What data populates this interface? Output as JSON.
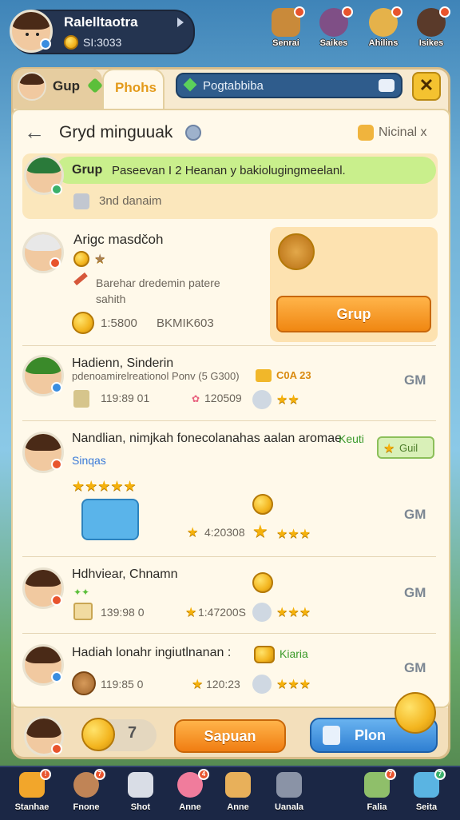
{
  "profile": {
    "name": "Ralelltaotra",
    "coins": "SI:3033"
  },
  "top_icons": [
    {
      "label": "Senrai",
      "icon": "shop-icon"
    },
    {
      "label": "Saikes",
      "icon": "character-icon"
    },
    {
      "label": "Ahilins",
      "icon": "hero-icon"
    },
    {
      "label": "Isikes",
      "icon": "girl-icon"
    }
  ],
  "tabs": {
    "first": "Gup",
    "second": "Phohs"
  },
  "search": {
    "text": "Pogtabbiba"
  },
  "panel": {
    "title": "Gryd minguuak",
    "right_label": "Nicinal x",
    "banner": {
      "title": "Grup",
      "text": "Paseevan I 2 Heanan y bakiolugingmeelanl.",
      "sub": "3nd danaim"
    }
  },
  "featured": {
    "title": "Arigc masdčoh",
    "line1": "Barehar dredemin patere",
    "line2": "sahith",
    "stat": "1:5800",
    "stat2": "BKMIK603",
    "button": "Grup"
  },
  "rows": [
    {
      "title": "Hadienn, Sinderin",
      "desc": "pdenoamirelreationol Ponv (5 G300)",
      "reward": "C0A 23",
      "time": "119:89 01",
      "code": "120509",
      "stars": "★★",
      "gm": "GM"
    },
    {
      "title": "Nandlian, nimjkah fonecolanahas aalan aromae",
      "tag": "Keuti",
      "sub": "Sinqas",
      "chip": "Guil",
      "time": "4:20308",
      "stars": "★★★",
      "gm": "GM",
      "rating": "★★★★★"
    },
    {
      "title": "Hdhviear, Chnamn",
      "time": "139:98 0",
      "code": "1:47200S",
      "stars": "★★★",
      "gm": "GM"
    },
    {
      "title": "Hadiah lonahr ingiutlnanan :",
      "tag": "Kiaria",
      "time": "119:85 0",
      "code": "120:23",
      "stars": "★★★",
      "gm": "GM"
    }
  ],
  "bottom": {
    "counter": "7",
    "primary": "Sapuan",
    "secondary": "Plon"
  },
  "nav": [
    {
      "label": "Stanhae",
      "badge": "!",
      "icon": "house-icon"
    },
    {
      "label": "Fnone",
      "badge": "7",
      "icon": "chat-icon"
    },
    {
      "label": "Shot",
      "badge": "",
      "icon": "ghost-icon"
    },
    {
      "label": "Anne",
      "badge": "4",
      "icon": "heart-icon"
    },
    {
      "label": "Anne",
      "badge": "",
      "icon": "gift-icon"
    },
    {
      "label": "Uanala",
      "badge": "",
      "icon": "controller-icon"
    },
    {
      "label": "Falia",
      "badge": "7",
      "icon": "book-icon"
    },
    {
      "label": "Seita",
      "badge": "7",
      "icon": "box-icon"
    }
  ],
  "colors": {
    "accent_orange": "#f29a1e",
    "accent_blue": "#3f8fd9",
    "panel": "#fff9ea",
    "star": "#f5b10c"
  }
}
